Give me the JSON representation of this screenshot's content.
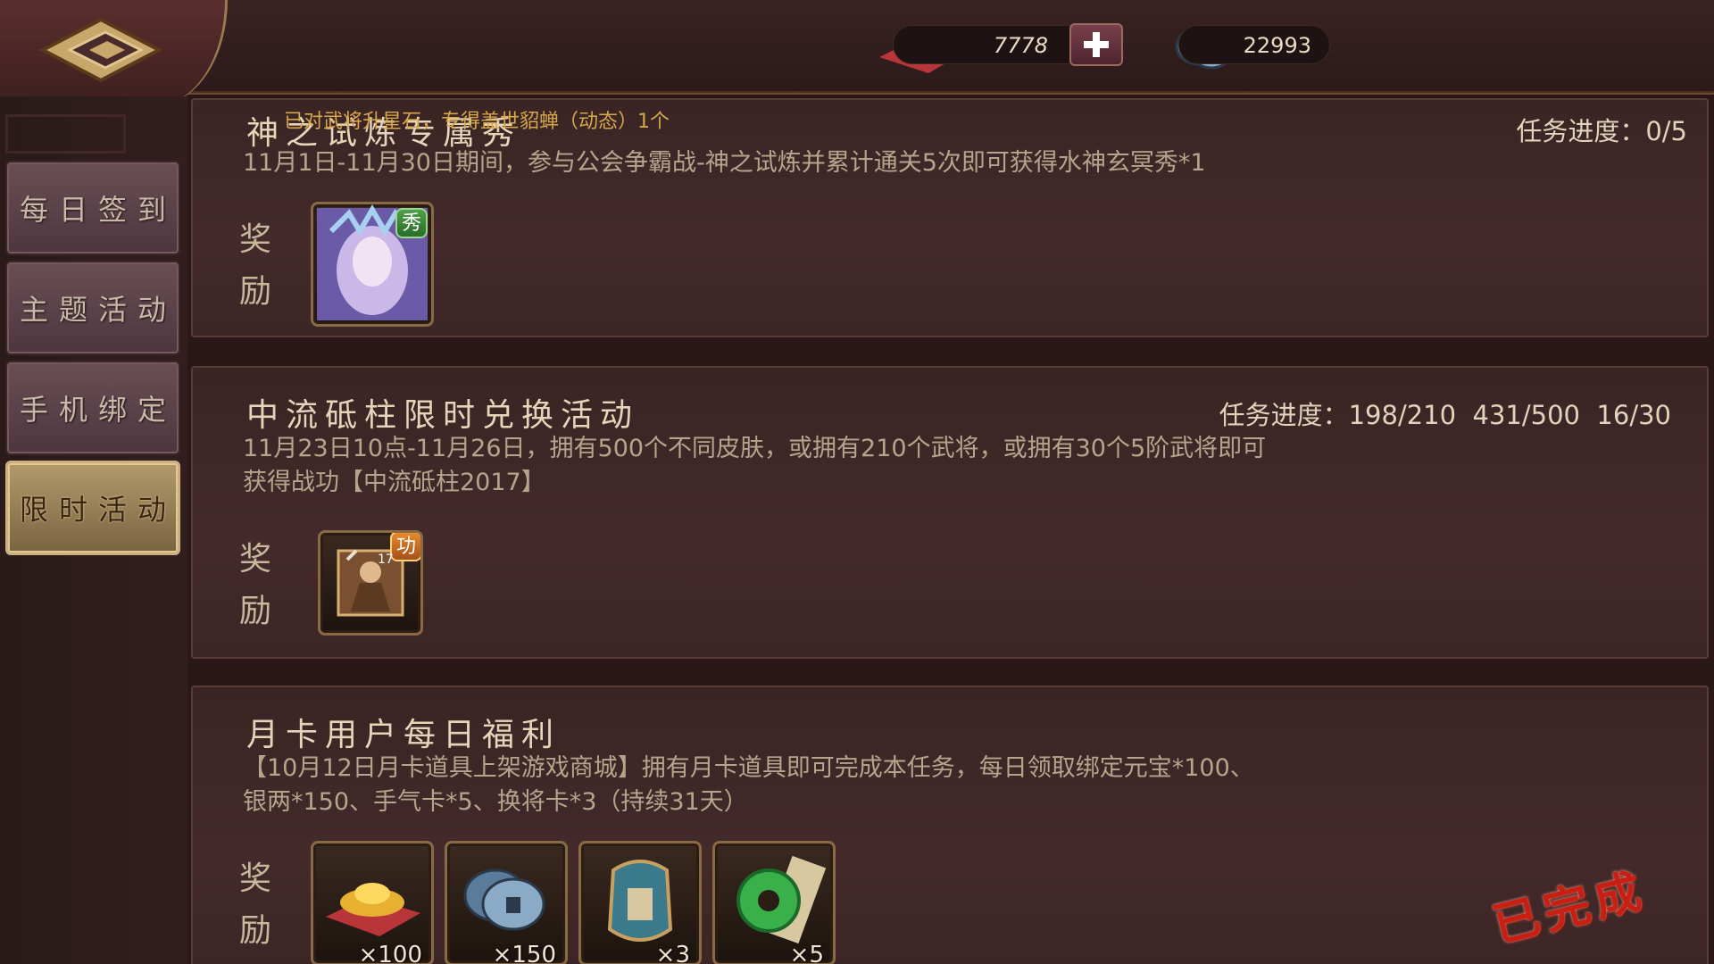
{
  "header": {
    "gold_amount": "7778",
    "silver_amount": "22993"
  },
  "sidebar": {
    "items": [
      {
        "label": "每日签到"
      },
      {
        "label": "主题活动"
      },
      {
        "label": "手机绑定"
      },
      {
        "label": "限时活动"
      }
    ]
  },
  "panels": [
    {
      "title": "神之试炼专属秀",
      "scroll_note": "已对武将升星石，专得盖世貂蝉（动态）1个",
      "progress": "任务进度：0/5",
      "description": "11月1日-11月30日期间，参与公会争霸战-神之试炼并累计通关5次即可获得水神玄冥秀*1",
      "reward_label": "奖励",
      "rewards": [
        {
          "icon": "water-goddess-skin-icon",
          "badge": "秀",
          "count": ""
        }
      ]
    },
    {
      "title": "中流砥柱限时兑换活动",
      "progress": "任务进度：198/210  431/500  16/30",
      "description_line1": "11月23日10点-11月26日，拥有500个不同皮肤，或拥有210个武将，或拥有30个5阶武将即可",
      "description_line2": "获得战功【中流砥柱2017】",
      "reward_label": "奖励",
      "rewards": [
        {
          "icon": "warrior-merit-icon",
          "badge": "功",
          "level": "17",
          "count": ""
        }
      ]
    },
    {
      "title": "月卡用户每日福利",
      "description_line1": "【10月12日月卡道具上架游戏商城】拥有月卡道具即可完成本任务，每日领取绑定元宝*100、",
      "description_line2": "银两*150、手气卡*5、换将卡*3（持续31天）",
      "reward_label": "奖励",
      "rewards": [
        {
          "icon": "gold-ingot-icon",
          "count": "×100"
        },
        {
          "icon": "silver-coin-icon",
          "count": "×150"
        },
        {
          "icon": "swap-general-card-icon",
          "count": "×3"
        },
        {
          "icon": "jade-luck-card-icon",
          "count": "×5"
        }
      ],
      "status": "已完成"
    }
  ],
  "colors": {
    "panel_bg": "#3a2424",
    "active_tab": "#b29a6c",
    "stamp_red": "#c81f12"
  }
}
